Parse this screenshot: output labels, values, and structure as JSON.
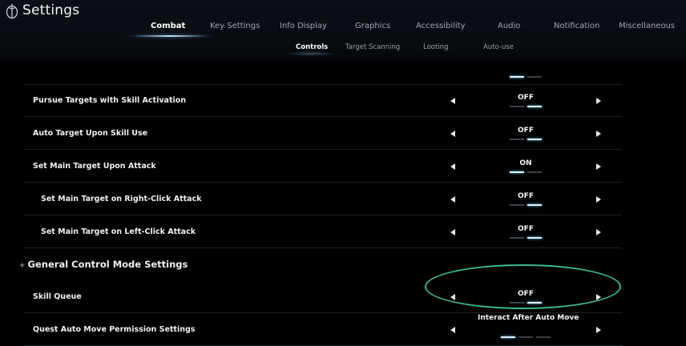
{
  "app": {
    "title": "Settings"
  },
  "tabs": [
    "Combat",
    "Key Settings",
    "Info Display",
    "Graphics",
    "Accessibility",
    "Audio",
    "Notification",
    "Miscellaneous"
  ],
  "subtabs": [
    "Controls",
    "Target Scanning",
    "Looting",
    "Auto-use"
  ],
  "rows": [
    {
      "label": "Pursue Targets with Skill Activation",
      "value": "OFF",
      "level": 1,
      "options": 2,
      "selected": 1
    },
    {
      "label": "Auto Target Upon Skill Use",
      "value": "OFF",
      "level": 1,
      "options": 2,
      "selected": 1
    },
    {
      "label": "Set Main Target Upon Attack",
      "value": "ON",
      "level": 1,
      "options": 2,
      "selected": 0
    },
    {
      "label": "Set Main Target on Right-Click Attack",
      "value": "OFF",
      "level": 2,
      "options": 2,
      "selected": 1
    },
    {
      "label": "Set Main Target on Left-Click Attack",
      "value": "OFF",
      "level": 2,
      "options": 2,
      "selected": 1
    }
  ],
  "section": {
    "prefix": "+",
    "label": "General Control Mode Settings"
  },
  "rows2": [
    {
      "label": "Skill Queue",
      "value": "OFF",
      "level": 1,
      "options": 2,
      "selected": 1
    },
    {
      "label": "Quest Auto Move Permission Settings",
      "value": "Interact After Auto Move",
      "level": 1,
      "options": 3,
      "selected": 0
    }
  ],
  "colors": {
    "accent": "#dff4ff",
    "highlight_ring": "#3cb88a",
    "background": "#000000"
  }
}
